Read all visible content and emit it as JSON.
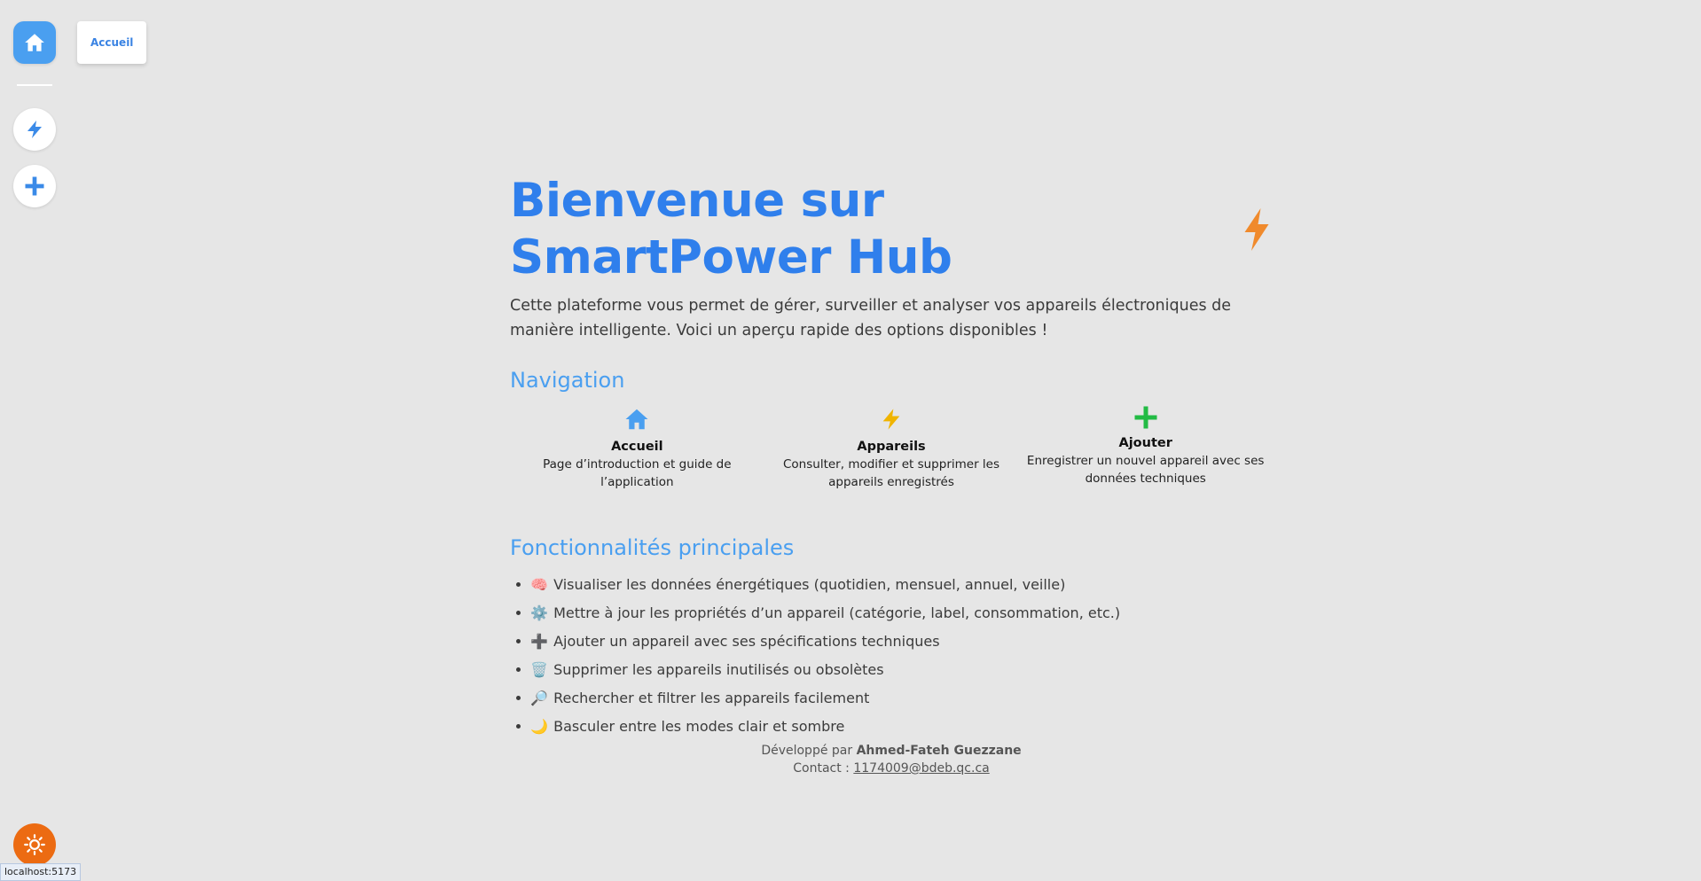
{
  "sidebar": {
    "tooltip": "Accueil",
    "items": [
      {
        "name": "Accueil",
        "icon": "home-icon"
      },
      {
        "name": "Appareils",
        "icon": "bolt-icon"
      },
      {
        "name": "Ajouter",
        "icon": "plus-icon"
      }
    ],
    "theme_icon": "sun-icon"
  },
  "status_url": "localhost:5173",
  "hero": {
    "title": "Bienvenue sur SmartPower Hub",
    "intro": "Cette plateforme vous permet de gérer, surveiller et analyser vos appareils électroniques de manière intelligente. Voici un aperçu rapide des options disponibles !"
  },
  "navigation": {
    "heading": "Navigation",
    "cards": [
      {
        "title": "Accueil",
        "description": "Page d’introduction et guide de l’application",
        "icon": "home-icon",
        "color": "#4a9ff0"
      },
      {
        "title": "Appareils",
        "description": "Consulter, modifier et supprimer les appareils enregistrés",
        "icon": "bolt-icon",
        "color": "#f0b400"
      },
      {
        "title": "Ajouter",
        "description": "Enregistrer un nouvel appareil avec ses données techniques",
        "icon": "plus-icon",
        "color": "#22bb44"
      }
    ]
  },
  "features": {
    "heading": "Fonctionnalités principales",
    "items": [
      {
        "emoji": "🧠",
        "text": "Visualiser les données énergétiques (quotidien, mensuel, annuel, veille)"
      },
      {
        "emoji": "⚙️",
        "text": "Mettre à jour les propriétés d’un appareil (catégorie, label, consommation, etc.)"
      },
      {
        "emoji": "➕",
        "text": "Ajouter un appareil avec ses spécifications techniques"
      },
      {
        "emoji": "🗑️",
        "text": "Supprimer les appareils inutilisés ou obsolètes"
      },
      {
        "emoji": "🔎",
        "text": "Rechercher et filtrer les appareils facilement"
      },
      {
        "emoji": "🌙",
        "text": "Basculer entre les modes clair et sombre"
      }
    ]
  },
  "footer": {
    "dev_prefix": "Développé par",
    "author": "Ahmed-Fateh Guezzane",
    "contact_prefix": "Contact :",
    "email": "1174009@bdeb.qc.ca"
  },
  "colors": {
    "accent": "#2f7fec",
    "heading_light": "#4a9ff0",
    "bolt_orange": "#f08a2c",
    "theme_button": "#ec6b12",
    "background": "#e6e6e6"
  }
}
